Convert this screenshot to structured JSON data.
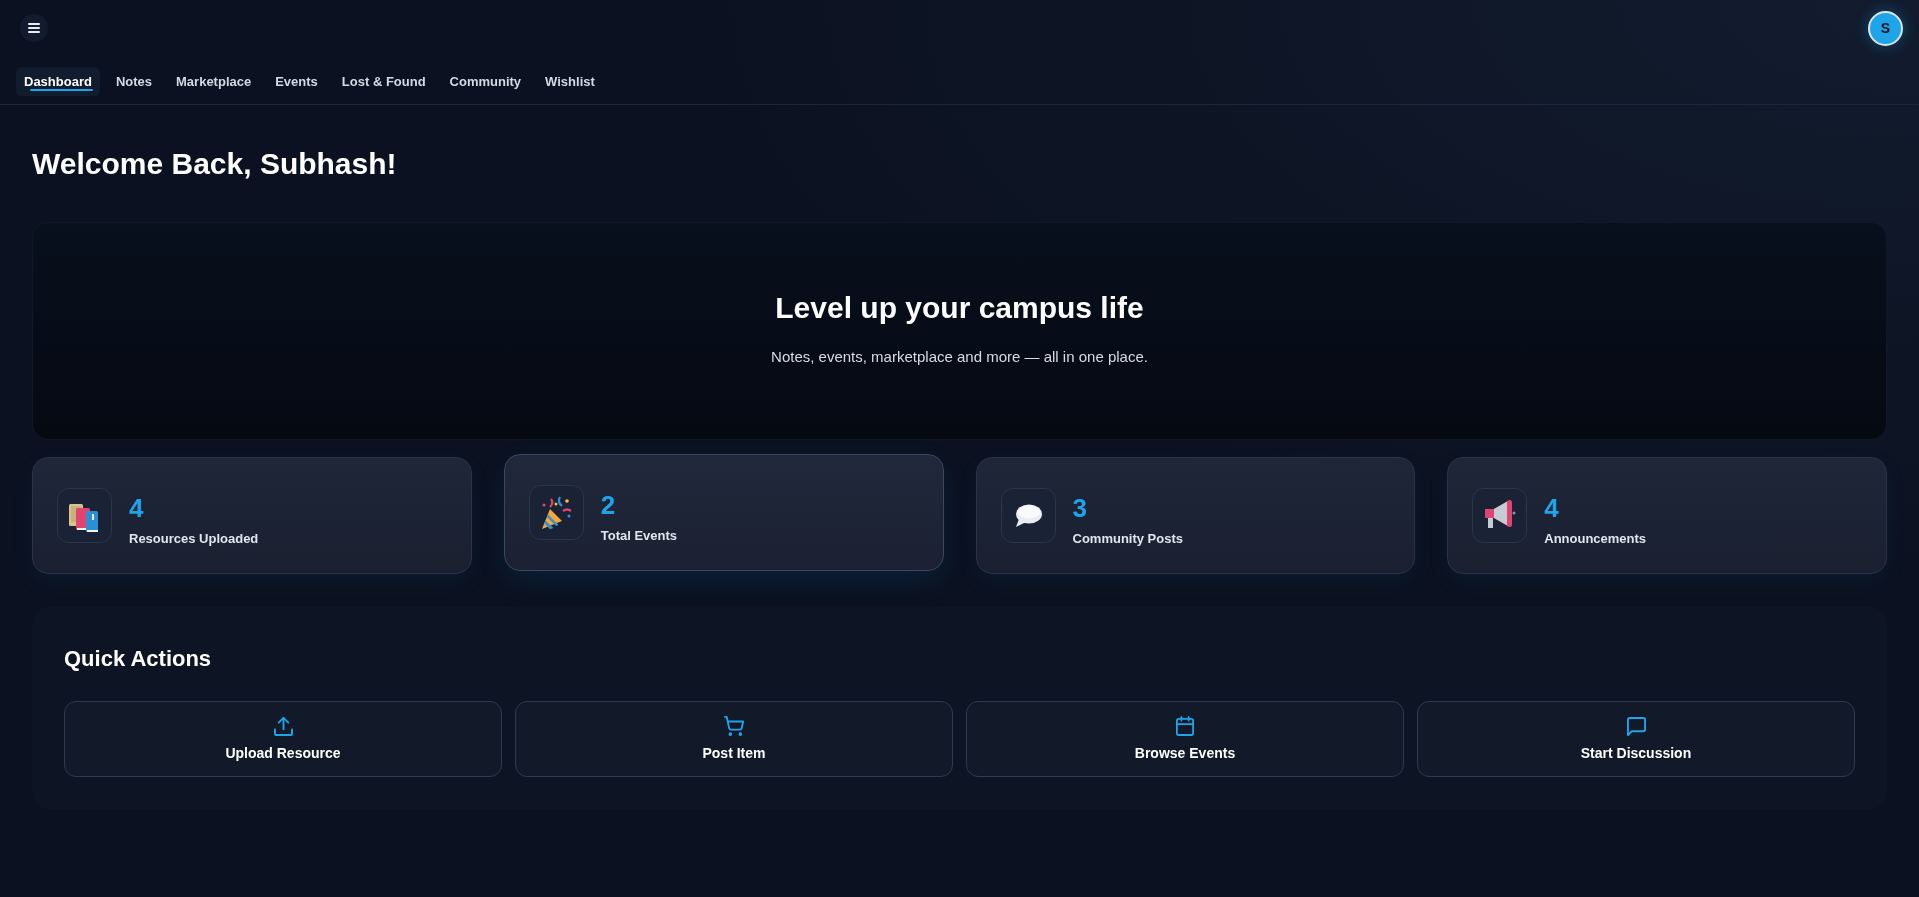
{
  "header": {
    "avatar_initial": "S"
  },
  "nav": {
    "tabs": [
      {
        "label": "Dashboard",
        "selected": true
      },
      {
        "label": "Notes",
        "selected": false
      },
      {
        "label": "Marketplace",
        "selected": false
      },
      {
        "label": "Events",
        "selected": false
      },
      {
        "label": "Lost & Found",
        "selected": false
      },
      {
        "label": "Community",
        "selected": false
      },
      {
        "label": "Wishlist",
        "selected": false
      }
    ]
  },
  "welcome": {
    "heading": "Welcome Back, Subhash!"
  },
  "hero": {
    "title": "Level up your campus life",
    "subtitle": "Notes, events, marketplace and more — all in one place."
  },
  "stats": [
    {
      "kind": "books",
      "value": "4",
      "label": "Resources Uploaded",
      "hovered": false
    },
    {
      "kind": "party",
      "value": "2",
      "label": "Total Events",
      "hovered": true
    },
    {
      "kind": "chat",
      "value": "3",
      "label": "Community Posts",
      "hovered": false
    },
    {
      "kind": "megaphone",
      "value": "4",
      "label": "Announcements",
      "hovered": false
    }
  ],
  "quick_actions": {
    "title": "Quick Actions",
    "actions": [
      {
        "kind": "upload",
        "label": "Upload Resource"
      },
      {
        "kind": "cart",
        "label": "Post Item"
      },
      {
        "kind": "calendar",
        "label": "Browse Events"
      },
      {
        "kind": "message",
        "label": "Start Discussion"
      }
    ]
  }
}
